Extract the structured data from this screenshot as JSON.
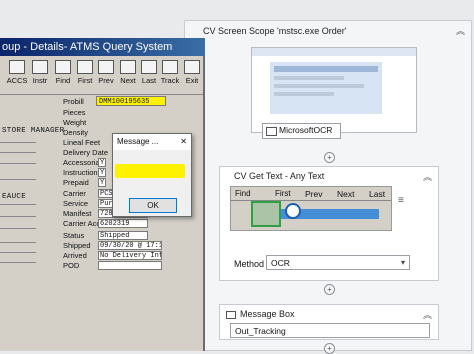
{
  "legacy": {
    "title": "oup - Details- ATMS Query System",
    "toolbar": [
      {
        "label": "ACCS",
        "icon": "accs-icon"
      },
      {
        "label": "Instr",
        "icon": "instructions-icon"
      },
      {
        "label": "Find",
        "icon": "find-icon"
      },
      {
        "label": "First",
        "icon": "first-icon"
      },
      {
        "label": "Prev",
        "icon": "prev-icon"
      },
      {
        "label": "Next",
        "icon": "next-icon"
      },
      {
        "label": "Last",
        "icon": "last-icon"
      },
      {
        "label": "Track",
        "icon": "track-icon"
      },
      {
        "label": "Exit",
        "icon": "exit-icon"
      }
    ],
    "probill_label": "Probill",
    "probill_value": "DMM100195635",
    "left_labels": [
      "STORE MANAGER",
      "EAUCE"
    ],
    "fields": [
      {
        "label": "Pieces",
        "value": ""
      },
      {
        "label": "Weight",
        "value": ""
      },
      {
        "label": "Density",
        "value": ""
      },
      {
        "label": "Lineal Feet",
        "value": ""
      },
      {
        "label": "Delivery Date",
        "value": ""
      },
      {
        "label": "Accessorials",
        "value": "Y"
      },
      {
        "label": "Instructions",
        "value": "Y"
      },
      {
        "label": "Prepaid",
        "value": "Y"
      },
      {
        "label": "Carrier",
        "value": "PCSL       Purolator Courier"
      },
      {
        "label": "Service",
        "value": "Purolator Ground"
      },
      {
        "label": "Manifest",
        "value": "7286774084"
      },
      {
        "label": "Carrier Acct",
        "value": "6202319"
      },
      {
        "label": "Status",
        "value": "Shipped"
      },
      {
        "label": "Shipped",
        "value": "09/30/20 @ 17:18"
      },
      {
        "label": "Arrived",
        "value": "No Delivery Info"
      },
      {
        "label": "POD",
        "value": ""
      }
    ]
  },
  "message_box": {
    "title": "Message ...",
    "close": "✕",
    "ok_label": "OK"
  },
  "uipath": {
    "screen_scope": {
      "title": "CV Screen Scope 'mstsc.exe Order'",
      "ocr_label": "MicrosoftOCR"
    },
    "get_text": {
      "title": "CV Get Text - Any Text",
      "preview_buttons": [
        "Find",
        "First",
        "Prev",
        "Next",
        "Last"
      ],
      "method_label": "Method",
      "method_value": "OCR"
    },
    "message_box": {
      "title": "Message Box",
      "value": "Out_Tracking"
    },
    "colors": {
      "highlight": "#fff200",
      "accent": "#0a246a",
      "ocr_box": "#2a82da"
    }
  }
}
